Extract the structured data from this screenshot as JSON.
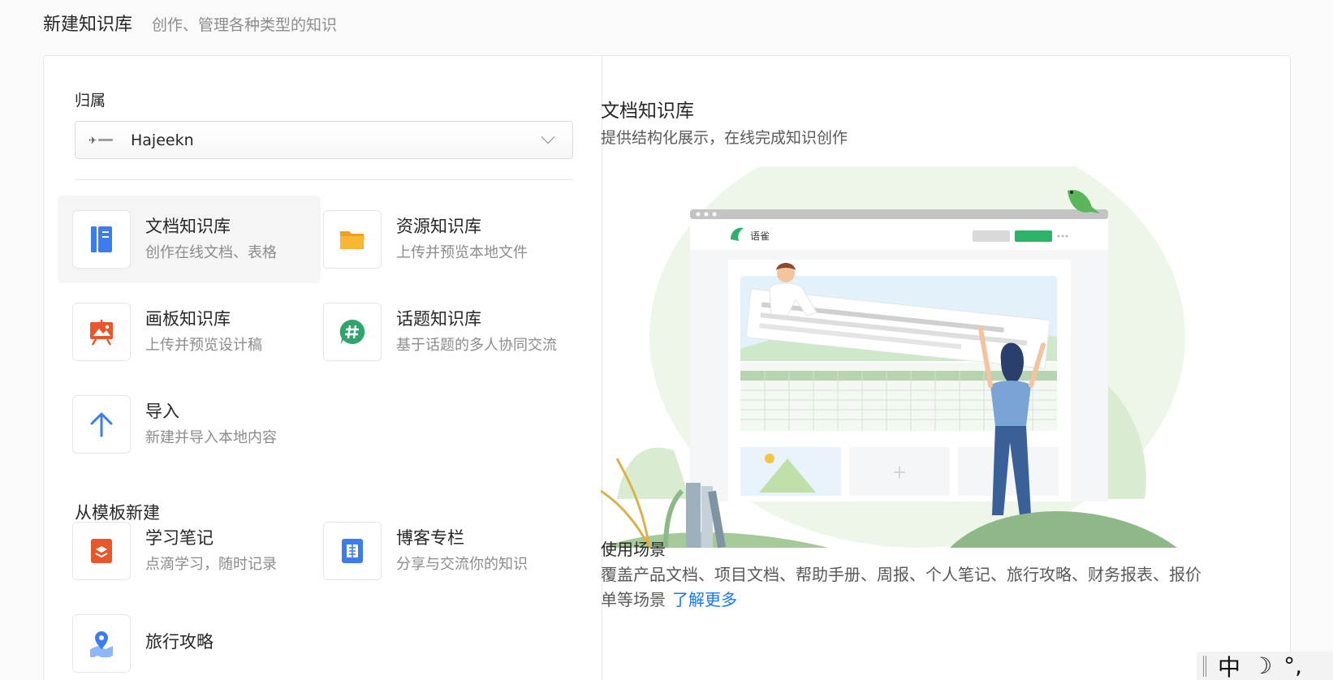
{
  "header": {
    "title": "新建知识库",
    "subtitle": "创作、管理各种类型的知识"
  },
  "owner": {
    "label": "归属",
    "selected": "Hajeekn"
  },
  "types": [
    {
      "name": "文档知识库",
      "desc": "创作在线文档、表格",
      "icon": "book-icon",
      "color": "#3b7cf0"
    },
    {
      "name": "资源知识库",
      "desc": "上传并预览本地文件",
      "icon": "folder-icon",
      "color": "#f5a623"
    },
    {
      "name": "画板知识库",
      "desc": "上传并预览设计稿",
      "icon": "easel-icon",
      "color": "#e8562a"
    },
    {
      "name": "话题知识库",
      "desc": "基于话题的多人协同交流",
      "icon": "hashtag-icon",
      "color": "#2ea56a"
    },
    {
      "name": "导入",
      "desc": "新建并导入本地内容",
      "icon": "arrow-up-icon",
      "color": "#3b7cf0"
    }
  ],
  "templates": {
    "label": "从模板新建",
    "items": [
      {
        "name": "学习笔记",
        "desc": "点滴学习，随时记录",
        "icon": "notebook-icon",
        "color": "#e8562a"
      },
      {
        "name": "博客专栏",
        "desc": "分享与交流你的知识",
        "icon": "blog-icon",
        "color": "#3b7cf0"
      },
      {
        "name": "旅行攻略",
        "desc": "",
        "icon": "map-pin-icon",
        "color": "#3b7cf0"
      }
    ]
  },
  "preview": {
    "title": "文档知识库",
    "desc": "提供结构化展示，在线完成知识创作",
    "app_name": "语雀",
    "scenario_title": "使用场景",
    "scenario_text": "覆盖产品文档、项目文档、帮助手册、周报、个人笔记、旅行攻略、财务报表、报价单等场景",
    "learn_more": "了解更多"
  },
  "ime": {
    "lang": "中",
    "moon": "☽",
    "punct": "°,"
  }
}
